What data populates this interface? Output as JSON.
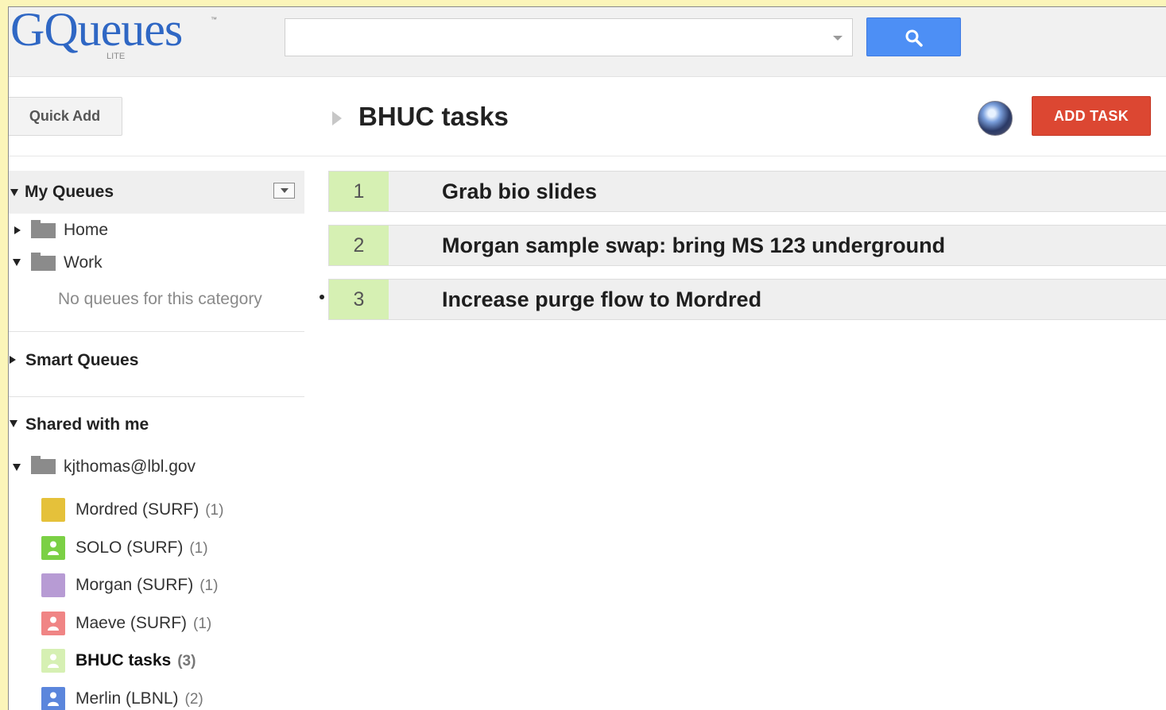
{
  "header": {
    "logo_text": "GQueues",
    "logo_tm": "™",
    "logo_sub": "LITE",
    "search": {
      "value": "",
      "placeholder": ""
    },
    "search_icon": "search-icon",
    "colors": {
      "search_button": "#4d8ff5",
      "logo": "#2f67c4"
    }
  },
  "toolbar": {
    "quick_add_label": "Quick Add",
    "page_title": "BHUC tasks",
    "add_task_label": "ADD TASK",
    "add_task_color": "#dc4732"
  },
  "sidebar": {
    "my_queues": {
      "title": "My Queues",
      "folders": [
        {
          "label": "Home",
          "expanded": false
        },
        {
          "label": "Work",
          "expanded": true
        }
      ],
      "empty_note": "No queues for this category"
    },
    "smart_queues": {
      "title": "Smart Queues"
    },
    "shared": {
      "title": "Shared with me",
      "folder": "kjthomas@lbl.gov",
      "queues": [
        {
          "name": "Mordred (SURF)",
          "count": "(1)",
          "color": "#e5c13a",
          "icon": "color-swatch",
          "bold": false
        },
        {
          "name": "SOLO (SURF)",
          "count": "(1)",
          "color": "#7bd045",
          "icon": "person-icon",
          "bold": false
        },
        {
          "name": "Morgan (SURF)",
          "count": "(1)",
          "color": "#b79bd4",
          "icon": "color-swatch",
          "bold": false
        },
        {
          "name": "Maeve (SURF)",
          "count": "(1)",
          "color": "#f08585",
          "icon": "person-icon",
          "bold": false
        },
        {
          "name": "BHUC tasks",
          "count": "(3)",
          "color": "#d6f0b3",
          "icon": "person-icon",
          "bold": true
        },
        {
          "name": "Merlin (LBNL)",
          "count": "(2)",
          "color": "#5b86dc",
          "icon": "person-icon",
          "bold": false
        }
      ]
    }
  },
  "tasks": [
    {
      "num": "1",
      "title": "Grab bio slides"
    },
    {
      "num": "2",
      "title": "Morgan sample swap: bring MS 123 underground"
    },
    {
      "num": "3",
      "title": "Increase purge flow to Mordred"
    }
  ]
}
